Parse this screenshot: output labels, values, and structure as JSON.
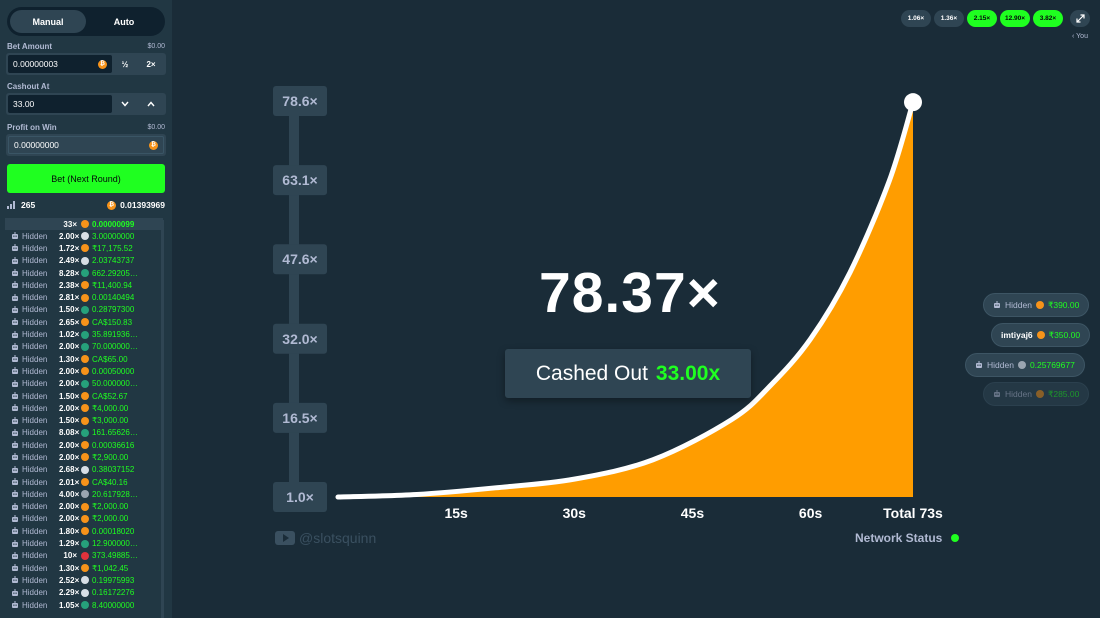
{
  "sidebar": {
    "tabs": [
      "Manual",
      "Auto"
    ],
    "bet_amount_label": "Bet Amount",
    "bet_amount_usd": "$0.00",
    "bet_amount_value": "0.00000003",
    "half_label": "½",
    "double_label": "2×",
    "cashout_label": "Cashout At",
    "cashout_value": "33.00",
    "profit_label": "Profit on Win",
    "profit_usd": "$0.00",
    "profit_value": "0.00000000",
    "bet_button": "Bet (Next Round)",
    "player_count": "265",
    "total_bet": "0.01393969",
    "header_mult": "33×",
    "header_amount": "0.00000099",
    "bets": [
      {
        "name": "Hidden",
        "mult": "2.00×",
        "amount": "3.00000000",
        "coin": "#d7dee5"
      },
      {
        "name": "Hidden",
        "mult": "1.72×",
        "amount": "₹17,175.52",
        "coin": "#f7931a"
      },
      {
        "name": "Hidden",
        "mult": "2.49×",
        "amount": "2.03743737",
        "coin": "#d7dee5"
      },
      {
        "name": "Hidden",
        "mult": "8.28×",
        "amount": "662.29205…",
        "coin": "#26a17b"
      },
      {
        "name": "Hidden",
        "mult": "2.38×",
        "amount": "₹11,400.94",
        "coin": "#f7931a"
      },
      {
        "name": "Hidden",
        "mult": "2.81×",
        "amount": "0.00140494",
        "coin": "#f7931a"
      },
      {
        "name": "Hidden",
        "mult": "1.50×",
        "amount": "0.28797300",
        "coin": "#26a17b"
      },
      {
        "name": "Hidden",
        "mult": "2.65×",
        "amount": "CA$150.83",
        "coin": "#f7931a"
      },
      {
        "name": "Hidden",
        "mult": "1.02×",
        "amount": "35.891936…",
        "coin": "#26a17b"
      },
      {
        "name": "Hidden",
        "mult": "2.00×",
        "amount": "70.000000…",
        "coin": "#26a17b"
      },
      {
        "name": "Hidden",
        "mult": "1.30×",
        "amount": "CA$65.00",
        "coin": "#f7931a"
      },
      {
        "name": "Hidden",
        "mult": "2.00×",
        "amount": "0.00050000",
        "coin": "#f7931a"
      },
      {
        "name": "Hidden",
        "mult": "2.00×",
        "amount": "50.000000…",
        "coin": "#26a17b"
      },
      {
        "name": "Hidden",
        "mult": "1.50×",
        "amount": "CA$52.67",
        "coin": "#f7931a"
      },
      {
        "name": "Hidden",
        "mult": "2.00×",
        "amount": "₹4,000.00",
        "coin": "#f7931a"
      },
      {
        "name": "Hidden",
        "mult": "1.50×",
        "amount": "₹3,000.00",
        "coin": "#f7931a"
      },
      {
        "name": "Hidden",
        "mult": "8.08×",
        "amount": "161.65626…",
        "coin": "#26a17b"
      },
      {
        "name": "Hidden",
        "mult": "2.00×",
        "amount": "0.00036616",
        "coin": "#f7931a"
      },
      {
        "name": "Hidden",
        "mult": "2.00×",
        "amount": "₹2,900.00",
        "coin": "#f7931a"
      },
      {
        "name": "Hidden",
        "mult": "2.68×",
        "amount": "0.38037152",
        "coin": "#d7dee5"
      },
      {
        "name": "Hidden",
        "mult": "2.01×",
        "amount": "CA$40.16",
        "coin": "#f7931a"
      },
      {
        "name": "Hidden",
        "mult": "4.00×",
        "amount": "20.617928…",
        "coin": "#9aa5b1"
      },
      {
        "name": "Hidden",
        "mult": "2.00×",
        "amount": "₹2,000.00",
        "coin": "#f7931a"
      },
      {
        "name": "Hidden",
        "mult": "2.00×",
        "amount": "₹2,000.00",
        "coin": "#f7931a"
      },
      {
        "name": "Hidden",
        "mult": "1.80×",
        "amount": "0.00018020",
        "coin": "#f7931a"
      },
      {
        "name": "Hidden",
        "mult": "1.29×",
        "amount": "12.900000…",
        "coin": "#26a17b"
      },
      {
        "name": "Hidden",
        "mult": "10×",
        "amount": "373.49885…",
        "coin": "#e0323c"
      },
      {
        "name": "Hidden",
        "mult": "1.30×",
        "amount": "₹1,042.45",
        "coin": "#f7931a"
      },
      {
        "name": "Hidden",
        "mult": "2.52×",
        "amount": "0.19975993",
        "coin": "#d7dee5"
      },
      {
        "name": "Hidden",
        "mult": "2.29×",
        "amount": "0.16172276",
        "coin": "#d7dee5"
      },
      {
        "name": "Hidden",
        "mult": "1.05×",
        "amount": "8.40000000",
        "coin": "#26a17b"
      }
    ]
  },
  "history": [
    {
      "label": "1.06×",
      "style": "grey"
    },
    {
      "label": "1.36×",
      "style": "grey"
    },
    {
      "label": "2.15×",
      "style": "green"
    },
    {
      "label": "12.90×",
      "style": "green"
    },
    {
      "label": "3.82×",
      "style": "green"
    }
  ],
  "you_label": "‹ You",
  "side_bets": [
    {
      "name": "Hidden",
      "amount": "₹390.00",
      "coin": "#f7931a",
      "faded": false
    },
    {
      "name": "imtiyaj6",
      "amount": "₹350.00",
      "coin": "#f7931a",
      "faded": false
    },
    {
      "name": "Hidden",
      "amount": "0.25769677",
      "coin": "#9aa5b1",
      "faded": false
    },
    {
      "name": "Hidden",
      "amount": "₹285.00",
      "coin": "#f7931a",
      "faded": true
    }
  ],
  "chart_data": {
    "type": "line",
    "y_ticks": [
      "78.6×",
      "63.1×",
      "47.6×",
      "32.0×",
      "16.5×",
      "1.0×"
    ],
    "x_ticks": [
      "15s",
      "30s",
      "45s",
      "60s",
      "Total 73s"
    ],
    "x_tick_values": [
      15,
      30,
      45,
      60,
      73
    ],
    "x": [
      0,
      10,
      20,
      30,
      40,
      50,
      55,
      60,
      65,
      70,
      73
    ],
    "y": [
      1.0,
      1.5,
      2.8,
      4.5,
      8.3,
      16.2,
      23,
      32,
      45,
      63,
      78.37
    ],
    "xlim": [
      0,
      73
    ],
    "ylim": [
      1.0,
      78.6
    ],
    "fill_color": "#ff9d00",
    "line_color": "#ffffff"
  },
  "current_multiplier": "78.37×",
  "cashed_out_label": "Cashed Out",
  "cashed_out_value": "33.00x",
  "network_status": "Network Status",
  "watermark": "@slotsquinn",
  "colors": {
    "accent": "#1fff20",
    "bg": "#1a2c38",
    "panel": "#213743"
  }
}
